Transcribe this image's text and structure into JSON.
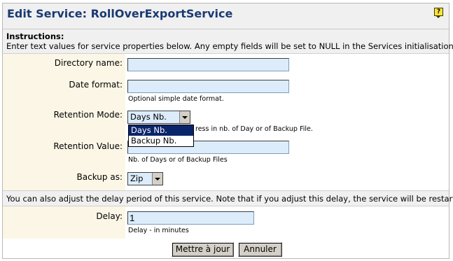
{
  "header": {
    "title": "Edit Service: RollOverExportService",
    "help_icon": "help-icon"
  },
  "instructions": {
    "heading": "Instructions:",
    "text": "Enter text values for service properties below. Any empty fields will be set to NULL in the Services initialisation."
  },
  "fields": {
    "directory_name": {
      "label": "Directory name:",
      "value": ""
    },
    "date_format": {
      "label": "Date format:",
      "value": "",
      "hint": "Optional simple date format."
    },
    "retention_mode": {
      "label": "Retention Mode:",
      "selected": "Days Nb.",
      "options": [
        "Days Nb.",
        "Backup Nb."
      ],
      "hint_visible": "ress in nb. of Day or of Backup File."
    },
    "retention_value": {
      "label": "Retention Value:",
      "value": "",
      "hint": "Nb. of Days or of Backup Files"
    },
    "backup_as": {
      "label": "Backup as:",
      "selected": "Zip"
    }
  },
  "delay_section": {
    "text": "You can also adjust the delay period of this service. Note that if you adjust this delay, the service will be restarted.",
    "label": "Delay:",
    "value": "1",
    "hint": "Delay - in minutes"
  },
  "buttons": {
    "submit": "Mettre à jour",
    "cancel": "Annuler"
  },
  "colors": {
    "title": "#1a3a73",
    "label_bg": "#fbf6e6",
    "field_bg": "#dcecfb",
    "band_bg": "#f0f0f0",
    "selection": "#0a246a"
  }
}
